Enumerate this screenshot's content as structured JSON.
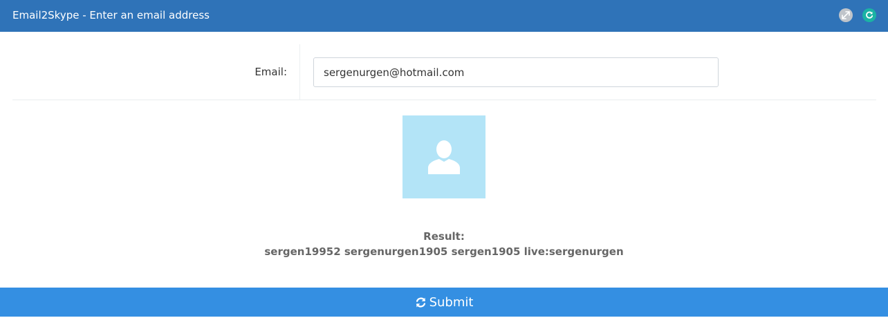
{
  "header": {
    "title": "Email2Skype - Enter an email address",
    "expand_icon": "expand-icon",
    "reload_icon": "reload-icon",
    "colors": {
      "bar": "#2f73b8",
      "expand": "#bfc4ca",
      "reload": "#1bb3a4"
    }
  },
  "form": {
    "email_label": "Email:",
    "email_value": "sergenurgen@hotmail.com"
  },
  "avatar": {
    "icon": "user-icon",
    "background": "#b3e4f7"
  },
  "result": {
    "heading": "Result:",
    "text": "sergen19952 sergenurgen1905 sergen1905 live:sergenurgen"
  },
  "submit": {
    "label": "Submit",
    "icon": "refresh-icon",
    "color": "#348fe2"
  }
}
